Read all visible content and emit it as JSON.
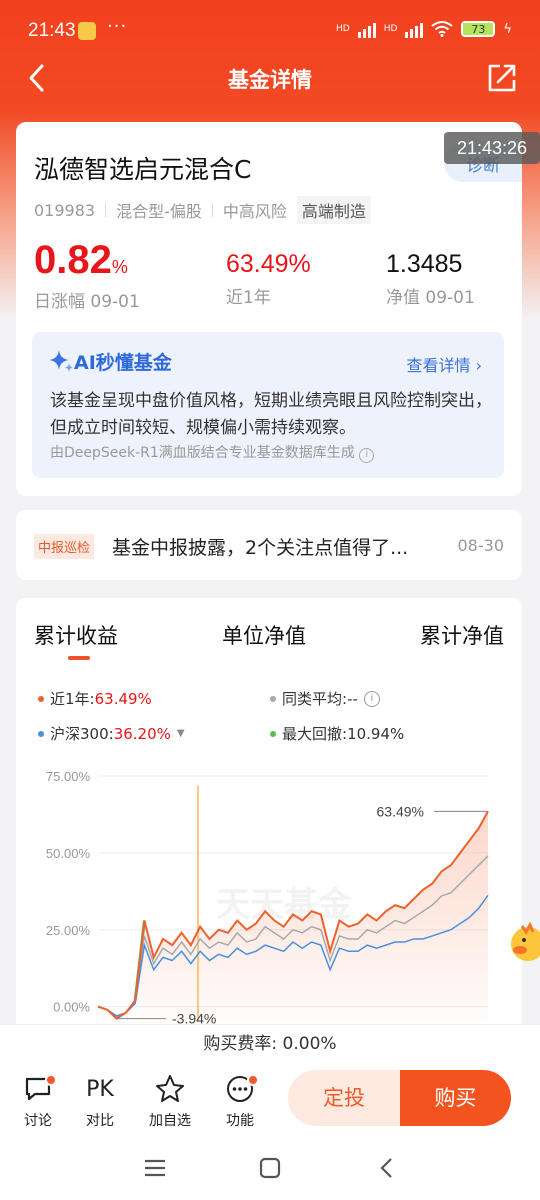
{
  "status": {
    "time": "21:43",
    "dots": "···",
    "hd1": "HD",
    "hd2": "HD",
    "battery": "73"
  },
  "nav": {
    "title": "基金详情"
  },
  "overlay_time": "21:43:26",
  "fund": {
    "name": "泓德智选启元混合C",
    "code": "019983",
    "type": "混合型-偏股",
    "risk": "中高风险",
    "theme": "高端制造",
    "diagnose": "诊断",
    "daily_change": "0.82",
    "daily_change_unit": "%",
    "daily_label": "日涨幅 09-01",
    "year_return": "63.49%",
    "year_label": "近1年",
    "nav_value": "1.3485",
    "nav_label": "净值 09-01"
  },
  "ai": {
    "title": "AI秒懂基金",
    "more": "查看详情",
    "text": "该基金呈现中盘价值风格，短期业绩亮眼且风险控制突出，但成立时间较短、规模偏小需持续观察。",
    "source": "由DeepSeek-R1满血版结合专业基金数据库生成"
  },
  "report": {
    "tag": "中报巡检",
    "text": "基金中报披露，2个关注点值得了...",
    "date": "08-30"
  },
  "tabs": [
    "累计收益",
    "单位净值",
    "累计净值"
  ],
  "legend": {
    "fund_label": "近1年:",
    "fund_value": "63.49%",
    "peer_label": "同类平均:",
    "peer_value": "--",
    "index_label": "沪深300:",
    "index_value": "36.20%",
    "drawdown_label": "最大回撤:",
    "drawdown_value": "10.94%"
  },
  "colors": {
    "fund": "#f0602c",
    "index": "#4a8fe0",
    "peer": "#a9a9a9",
    "drawdown": "#5cbc5c",
    "accent": "#f2531f"
  },
  "chart_data": {
    "type": "line",
    "y_ticks": [
      "75.00%",
      "50.00%",
      "25.00%",
      "0.00%"
    ],
    "ylim": [
      -5,
      75
    ],
    "annotations": {
      "end_value": "63.49%",
      "min_value": "-3.94%"
    },
    "watermark": "天天基金",
    "series": [
      {
        "name": "近1年",
        "values": [
          0,
          -1,
          -3.9,
          -2,
          2,
          28,
          16,
          22,
          20,
          24,
          20,
          26,
          22,
          25,
          24,
          28,
          25,
          27,
          31,
          28,
          26,
          30,
          28,
          31,
          30,
          18,
          28,
          26,
          27,
          30,
          28,
          31,
          33,
          32,
          35,
          38,
          40,
          44,
          46,
          50,
          54,
          58,
          63.49
        ]
      },
      {
        "name": "沪深300",
        "values": [
          0,
          -1,
          -3,
          -2,
          1,
          20,
          12,
          16,
          15,
          18,
          14,
          18,
          15,
          17,
          16,
          19,
          17,
          18,
          20,
          19,
          18,
          21,
          19,
          21,
          20,
          12,
          19,
          18,
          18,
          20,
          19,
          20,
          21,
          21,
          22,
          22,
          23,
          24,
          25,
          27,
          29,
          32,
          36.2
        ]
      },
      {
        "name": "同类平均",
        "values": [
          0,
          -1,
          -3.5,
          -2,
          1.5,
          23,
          14,
          19,
          17,
          21,
          17,
          22,
          19,
          21,
          20,
          24,
          21,
          22,
          26,
          24,
          22,
          25,
          24,
          26,
          25,
          15,
          23,
          22,
          22,
          25,
          24,
          26,
          28,
          27,
          29,
          31,
          33,
          36,
          37,
          40,
          43,
          46,
          49
        ]
      }
    ]
  },
  "fee": {
    "text": "购买费率: 0.00%"
  },
  "bottom": {
    "discuss": "讨论",
    "pk": "PK",
    "compare": "对比",
    "add_watch": "加自选",
    "functions": "功能",
    "regular": "定投",
    "buy": "购买"
  }
}
